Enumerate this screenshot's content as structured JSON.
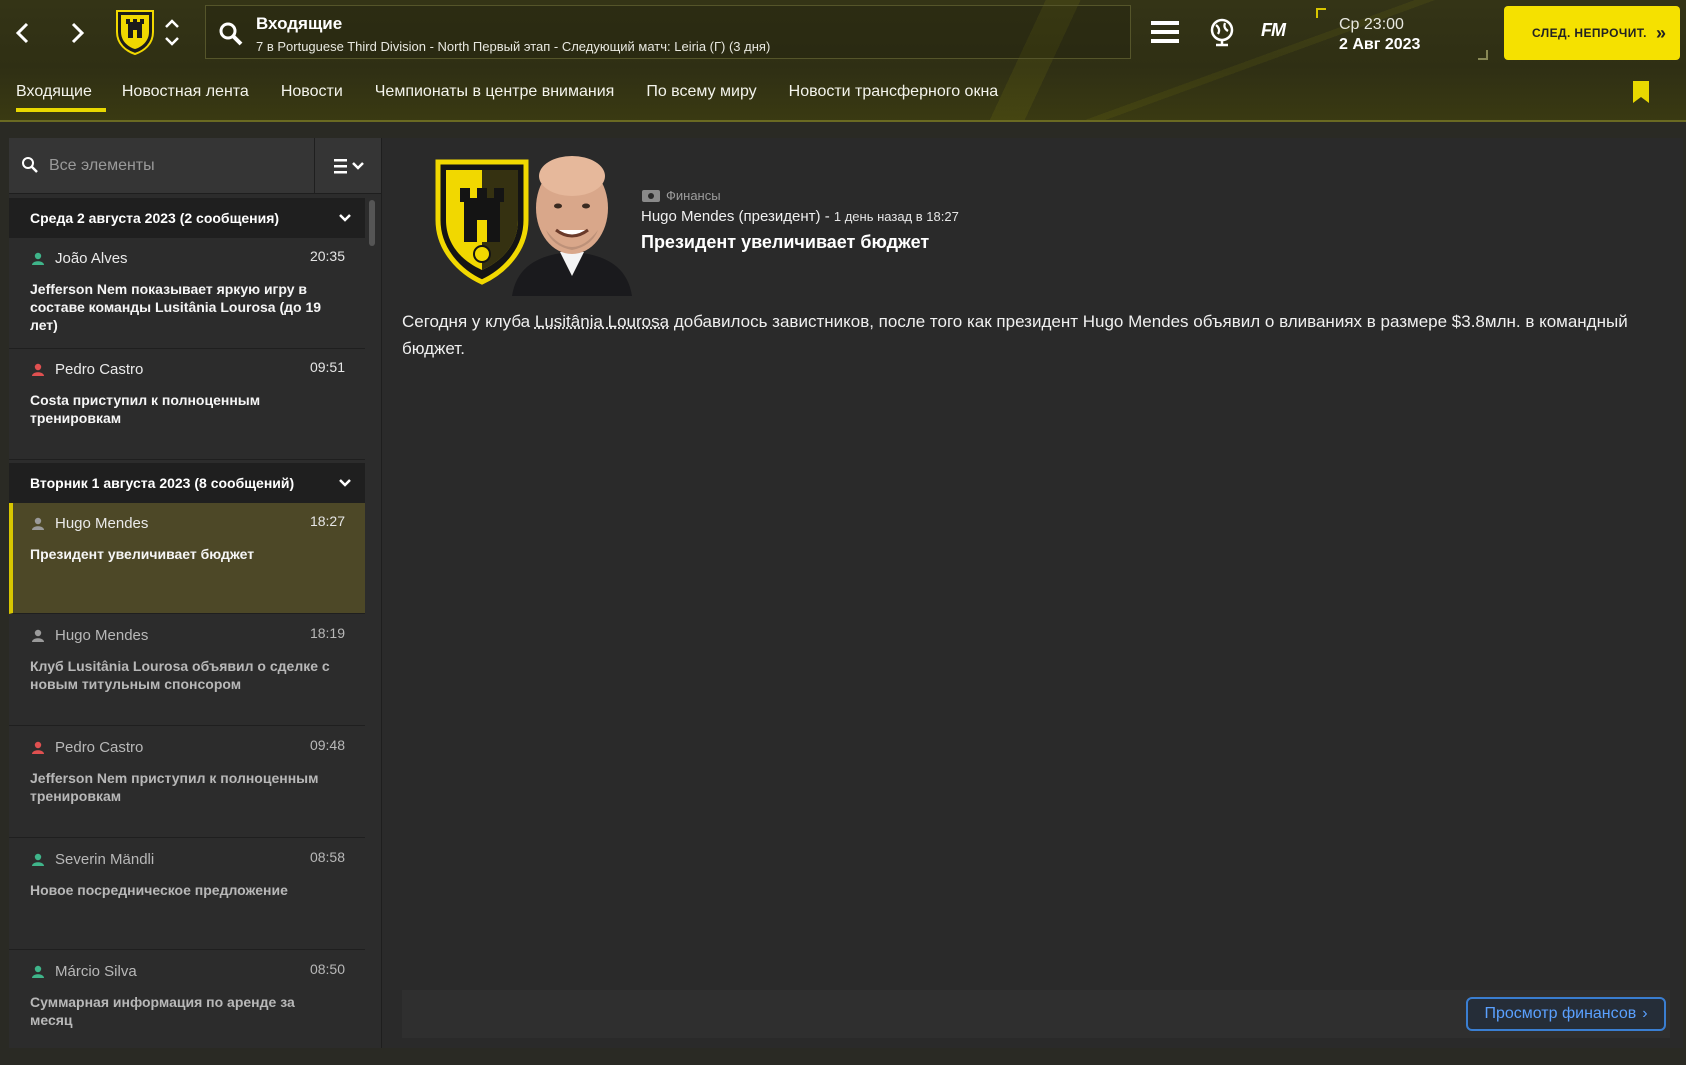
{
  "header": {
    "back_label": "‹",
    "forward_label": "›",
    "search_title": "Входящие",
    "search_subtitle": "7 в Portuguese Third Division - North Первый этап - Следующий матч: Leiria (Г) (3 дня)",
    "fm_logo": "FM",
    "date_time": "Ср 23:00",
    "date_date": "2 Авг 2023",
    "continue_label": "СЛЕД. НЕПРОЧИТ.",
    "continue_arrow": "»"
  },
  "tabs": [
    {
      "label": "Входящие",
      "active": true
    },
    {
      "label": "Новостная лента"
    },
    {
      "label": "Новости"
    },
    {
      "label": "Чемпионаты в центре внимания"
    },
    {
      "label": "По всему миру"
    },
    {
      "label": "Новости трансферного окна"
    }
  ],
  "sidebar": {
    "filter_placeholder": "Все элементы",
    "groups": [
      {
        "title": "Среда 2 августа 2023 (2 сообщения)",
        "messages": [
          {
            "sender": "João Alves",
            "time": "20:35",
            "subject": "Jefferson Nem показывает яркую игру в составе команды Lusitânia Lourosa (до 19 лет)",
            "icon_color": "#3fb58a"
          },
          {
            "sender": "Pedro Castro",
            "time": "09:51",
            "subject": "Costa приступил к полноценным тренировкам",
            "icon_color": "#e05050"
          }
        ]
      },
      {
        "title": "Вторник 1 августа 2023 (8 сообщений)",
        "messages": [
          {
            "sender": "Hugo Mendes",
            "time": "18:27",
            "subject": "Президент увеличивает бюджет",
            "icon_color": "#9a9a9a"
          },
          {
            "sender": "Hugo Mendes",
            "time": "18:19",
            "subject": "Клуб Lusitânia Lourosa объявил о сделке с новым титульным спонсором",
            "icon_color": "#9a9a9a"
          },
          {
            "sender": "Pedro Castro",
            "time": "09:48",
            "subject": "Jefferson Nem приступил к полноценным тренировкам",
            "icon_color": "#e05050"
          },
          {
            "sender": "Severin Mändli",
            "time": "08:58",
            "subject": "Новое посредническое предложение",
            "icon_color": "#3fb58a"
          },
          {
            "sender": "Márcio Silva",
            "time": "08:50",
            "subject": "Суммарная информация по аренде за месяц",
            "icon_color": "#3fb58a"
          }
        ]
      }
    ]
  },
  "message": {
    "category": "Финансы",
    "from": "Hugo Mendes (президент)",
    "separator": " - ",
    "ago": "1 день назад в 18:27",
    "headline": "Президент увеличивает бюджет",
    "body_before": "Сегодня у клуба ",
    "body_club": "Lusitânia Lourosa",
    "body_after": " добавилось завистников, после того как президент Hugo Mendes объявил о вливаниях в размере $3.8млн. в командный бюджет.",
    "finance_button": "Просмотр финансов",
    "finance_arrow": "›"
  },
  "colors": {
    "accent": "#f5e100",
    "topbar": "#33331a",
    "selected_row": "#4d4827",
    "link_blue": "#5aa0ff"
  }
}
